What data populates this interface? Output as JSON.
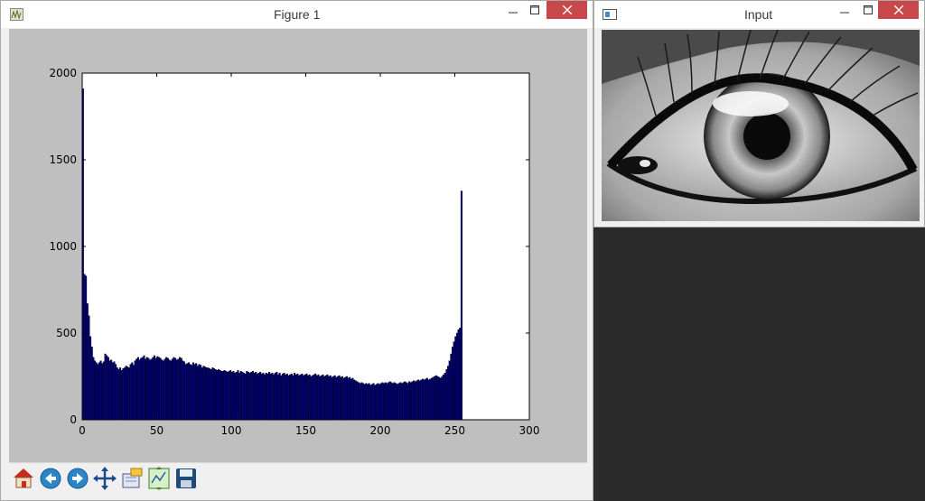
{
  "figure_window": {
    "title": "Figure 1",
    "icon": "matplotlib-figure-icon",
    "controls": [
      "minimize",
      "maximize",
      "close"
    ]
  },
  "input_window": {
    "title": "Input",
    "icon": "opencv-window-icon",
    "image": "grayscale-eye-photo"
  },
  "toolbar": {
    "buttons": [
      {
        "name": "home-icon"
      },
      {
        "name": "back-arrow-icon"
      },
      {
        "name": "forward-arrow-icon"
      },
      {
        "name": "pan-move-icon"
      },
      {
        "name": "zoom-rect-icon"
      },
      {
        "name": "subplots-config-icon"
      },
      {
        "name": "save-floppy-icon"
      }
    ]
  },
  "chart_data": {
    "type": "bar",
    "title": "",
    "xlabel": "",
    "ylabel": "",
    "xlim": [
      0,
      300
    ],
    "ylim": [
      0,
      2000
    ],
    "xticks": [
      0,
      50,
      100,
      150,
      200,
      250,
      300
    ],
    "yticks": [
      0,
      500,
      1000,
      1500,
      2000
    ],
    "bar_color": "#000080",
    "bin_width": 1,
    "x": [
      0,
      1,
      2,
      3,
      4,
      5,
      6,
      7,
      8,
      9,
      10,
      11,
      12,
      13,
      14,
      15,
      16,
      17,
      18,
      19,
      20,
      21,
      22,
      23,
      24,
      25,
      26,
      27,
      28,
      29,
      30,
      31,
      32,
      33,
      34,
      35,
      36,
      37,
      38,
      39,
      40,
      41,
      42,
      43,
      44,
      45,
      46,
      47,
      48,
      49,
      50,
      51,
      52,
      53,
      54,
      55,
      56,
      57,
      58,
      59,
      60,
      61,
      62,
      63,
      64,
      65,
      66,
      67,
      68,
      69,
      70,
      71,
      72,
      73,
      74,
      75,
      76,
      77,
      78,
      79,
      80,
      81,
      82,
      83,
      84,
      85,
      86,
      87,
      88,
      89,
      90,
      91,
      92,
      93,
      94,
      95,
      96,
      97,
      98,
      99,
      100,
      101,
      102,
      103,
      104,
      105,
      106,
      107,
      108,
      109,
      110,
      111,
      112,
      113,
      114,
      115,
      116,
      117,
      118,
      119,
      120,
      121,
      122,
      123,
      124,
      125,
      126,
      127,
      128,
      129,
      130,
      131,
      132,
      133,
      134,
      135,
      136,
      137,
      138,
      139,
      140,
      141,
      142,
      143,
      144,
      145,
      146,
      147,
      148,
      149,
      150,
      151,
      152,
      153,
      154,
      155,
      156,
      157,
      158,
      159,
      160,
      161,
      162,
      163,
      164,
      165,
      166,
      167,
      168,
      169,
      170,
      171,
      172,
      173,
      174,
      175,
      176,
      177,
      178,
      179,
      180,
      181,
      182,
      183,
      184,
      185,
      186,
      187,
      188,
      189,
      190,
      191,
      192,
      193,
      194,
      195,
      196,
      197,
      198,
      199,
      200,
      201,
      202,
      203,
      204,
      205,
      206,
      207,
      208,
      209,
      210,
      211,
      212,
      213,
      214,
      215,
      216,
      217,
      218,
      219,
      220,
      221,
      222,
      223,
      224,
      225,
      226,
      227,
      228,
      229,
      230,
      231,
      232,
      233,
      234,
      235,
      236,
      237,
      238,
      239,
      240,
      241,
      242,
      243,
      244,
      245,
      246,
      247,
      248,
      249,
      250,
      251,
      252,
      253,
      254,
      255
    ],
    "values": [
      1910,
      840,
      830,
      670,
      600,
      480,
      420,
      360,
      340,
      330,
      320,
      330,
      340,
      325,
      335,
      380,
      370,
      360,
      340,
      345,
      330,
      335,
      320,
      300,
      290,
      300,
      285,
      295,
      300,
      310,
      305,
      300,
      320,
      330,
      315,
      340,
      350,
      360,
      345,
      355,
      360,
      370,
      350,
      360,
      355,
      345,
      350,
      360,
      370,
      355,
      365,
      360,
      355,
      345,
      340,
      350,
      360,
      355,
      345,
      340,
      350,
      360,
      355,
      345,
      350,
      360,
      355,
      340,
      335,
      320,
      325,
      330,
      320,
      315,
      330,
      320,
      325,
      310,
      320,
      315,
      300,
      310,
      305,
      300,
      300,
      295,
      290,
      300,
      295,
      290,
      285,
      290,
      285,
      280,
      280,
      285,
      280,
      275,
      280,
      285,
      275,
      280,
      270,
      275,
      285,
      270,
      280,
      275,
      270,
      265,
      280,
      275,
      270,
      275,
      280,
      270,
      275,
      265,
      270,
      275,
      265,
      270,
      260,
      270,
      265,
      275,
      265,
      270,
      260,
      270,
      275,
      260,
      270,
      255,
      265,
      270,
      260,
      265,
      255,
      260,
      265,
      255,
      270,
      260,
      265,
      255,
      260,
      265,
      255,
      260,
      265,
      255,
      260,
      250,
      255,
      260,
      265,
      255,
      260,
      250,
      255,
      260,
      250,
      255,
      260,
      250,
      255,
      245,
      250,
      255,
      245,
      250,
      255,
      245,
      250,
      240,
      245,
      250,
      240,
      245,
      235,
      240,
      230,
      225,
      220,
      215,
      210,
      215,
      210,
      205,
      210,
      205,
      210,
      200,
      205,
      210,
      200,
      205,
      210,
      205,
      210,
      215,
      210,
      215,
      210,
      215,
      220,
      215,
      210,
      215,
      210,
      205,
      210,
      215,
      210,
      215,
      220,
      215,
      210,
      220,
      215,
      220,
      225,
      220,
      225,
      230,
      225,
      230,
      235,
      230,
      235,
      240,
      230,
      235,
      240,
      245,
      250,
      255,
      250,
      245,
      240,
      250,
      260,
      270,
      290,
      310,
      340,
      380,
      420,
      450,
      480,
      500,
      520,
      530,
      1320
    ]
  }
}
